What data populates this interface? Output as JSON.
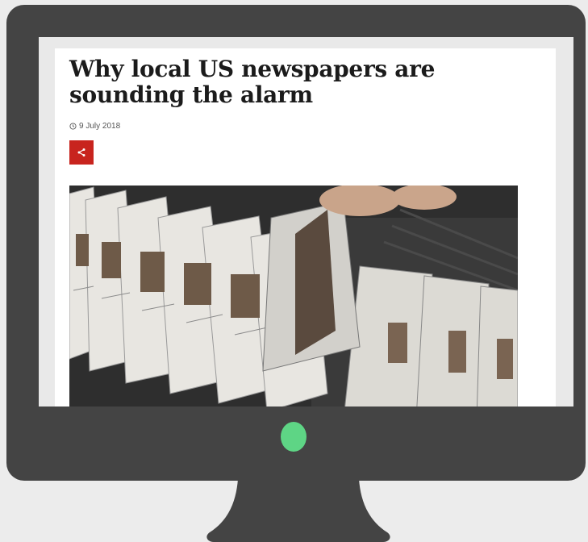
{
  "article": {
    "headline": "Why local US newspapers are sounding the alarm",
    "date": "9 July 2018",
    "share_icon": "share-icon",
    "clock_icon": "clock-icon"
  },
  "colors": {
    "monitor_frame": "#444444",
    "power_led": "#5ed585",
    "share_button": "#c8241e",
    "background": "#ececec"
  }
}
